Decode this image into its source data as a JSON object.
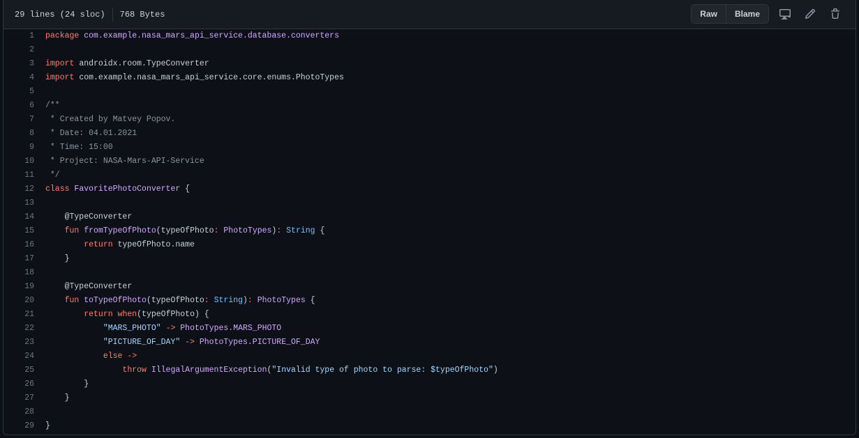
{
  "header": {
    "lines_info": "29 lines (24 sloc)",
    "size_info": "768 Bytes",
    "raw_label": "Raw",
    "blame_label": "Blame"
  },
  "icons": {
    "display": "desktop-icon",
    "edit": "pencil-icon",
    "delete": "trash-icon"
  },
  "colors": {
    "keyword": "#ff7b72",
    "type": "#d2a8ff",
    "string": "#a5d6ff",
    "comment": "#8b949e",
    "builtin": "#79c0ff",
    "text": "#c9d1d9",
    "background": "#0d1117"
  },
  "code": {
    "lines": [
      [
        {
          "c": "k",
          "t": "package"
        },
        {
          "c": "p",
          "t": " "
        },
        {
          "c": "t",
          "t": "com.example.nasa_mars_api_service.database.converters"
        }
      ],
      [],
      [
        {
          "c": "k",
          "t": "import"
        },
        {
          "c": "p",
          "t": " androidx.room.TypeConverter"
        }
      ],
      [
        {
          "c": "k",
          "t": "import"
        },
        {
          "c": "p",
          "t": " com.example.nasa_mars_api_service.core.enums.PhotoTypes"
        }
      ],
      [],
      [
        {
          "c": "c",
          "t": "/**"
        }
      ],
      [
        {
          "c": "c",
          "t": " * Created by Matvey Popov."
        }
      ],
      [
        {
          "c": "c",
          "t": " * Date: 04.01.2021"
        }
      ],
      [
        {
          "c": "c",
          "t": " * Time: 15:00"
        }
      ],
      [
        {
          "c": "c",
          "t": " * Project: NASA-Mars-API-Service"
        }
      ],
      [
        {
          "c": "c",
          "t": " */"
        }
      ],
      [
        {
          "c": "k",
          "t": "class"
        },
        {
          "c": "p",
          "t": " "
        },
        {
          "c": "t",
          "t": "FavoritePhotoConverter"
        },
        {
          "c": "p",
          "t": " {"
        }
      ],
      [],
      [
        {
          "c": "p",
          "t": "    @TypeConverter"
        }
      ],
      [
        {
          "c": "p",
          "t": "    "
        },
        {
          "c": "k",
          "t": "fun"
        },
        {
          "c": "p",
          "t": " "
        },
        {
          "c": "t",
          "t": "fromTypeOfPhoto"
        },
        {
          "c": "p",
          "t": "(typeOfPhoto"
        },
        {
          "c": "k",
          "t": ":"
        },
        {
          "c": "p",
          "t": " "
        },
        {
          "c": "t",
          "t": "PhotoTypes"
        },
        {
          "c": "p",
          "t": ")"
        },
        {
          "c": "k",
          "t": ":"
        },
        {
          "c": "p",
          "t": " "
        },
        {
          "c": "n",
          "t": "String"
        },
        {
          "c": "p",
          "t": " {"
        }
      ],
      [
        {
          "c": "p",
          "t": "        "
        },
        {
          "c": "k",
          "t": "return"
        },
        {
          "c": "p",
          "t": " typeOfPhoto.name"
        }
      ],
      [
        {
          "c": "p",
          "t": "    }"
        }
      ],
      [],
      [
        {
          "c": "p",
          "t": "    @TypeConverter"
        }
      ],
      [
        {
          "c": "p",
          "t": "    "
        },
        {
          "c": "k",
          "t": "fun"
        },
        {
          "c": "p",
          "t": " "
        },
        {
          "c": "t",
          "t": "toTypeOfPhoto"
        },
        {
          "c": "p",
          "t": "(typeOfPhoto"
        },
        {
          "c": "k",
          "t": ":"
        },
        {
          "c": "p",
          "t": " "
        },
        {
          "c": "n",
          "t": "String"
        },
        {
          "c": "p",
          "t": ")"
        },
        {
          "c": "k",
          "t": ":"
        },
        {
          "c": "p",
          "t": " "
        },
        {
          "c": "t",
          "t": "PhotoTypes"
        },
        {
          "c": "p",
          "t": " {"
        }
      ],
      [
        {
          "c": "p",
          "t": "        "
        },
        {
          "c": "k",
          "t": "return"
        },
        {
          "c": "p",
          "t": " "
        },
        {
          "c": "k",
          "t": "when"
        },
        {
          "c": "p",
          "t": "(typeOfPhoto) {"
        }
      ],
      [
        {
          "c": "p",
          "t": "            "
        },
        {
          "c": "s",
          "t": "\"MARS_PHOTO\""
        },
        {
          "c": "p",
          "t": " "
        },
        {
          "c": "k",
          "t": "->"
        },
        {
          "c": "p",
          "t": " "
        },
        {
          "c": "t",
          "t": "PhotoTypes.MARS_PHOTO"
        }
      ],
      [
        {
          "c": "p",
          "t": "            "
        },
        {
          "c": "s",
          "t": "\"PICTURE_OF_DAY\""
        },
        {
          "c": "p",
          "t": " "
        },
        {
          "c": "k",
          "t": "->"
        },
        {
          "c": "p",
          "t": " "
        },
        {
          "c": "t",
          "t": "PhotoTypes.PICTURE_OF_DAY"
        }
      ],
      [
        {
          "c": "p",
          "t": "            "
        },
        {
          "c": "k",
          "t": "else"
        },
        {
          "c": "p",
          "t": " "
        },
        {
          "c": "k",
          "t": "->"
        }
      ],
      [
        {
          "c": "p",
          "t": "                "
        },
        {
          "c": "k",
          "t": "throw"
        },
        {
          "c": "p",
          "t": " "
        },
        {
          "c": "t",
          "t": "IllegalArgumentException"
        },
        {
          "c": "p",
          "t": "("
        },
        {
          "c": "s",
          "t": "\"Invalid type of photo to parse: $typeOfPhoto\""
        },
        {
          "c": "p",
          "t": ")"
        }
      ],
      [
        {
          "c": "p",
          "t": "        }"
        }
      ],
      [
        {
          "c": "p",
          "t": "    }"
        }
      ],
      [],
      [
        {
          "c": "p",
          "t": "}"
        }
      ]
    ]
  }
}
